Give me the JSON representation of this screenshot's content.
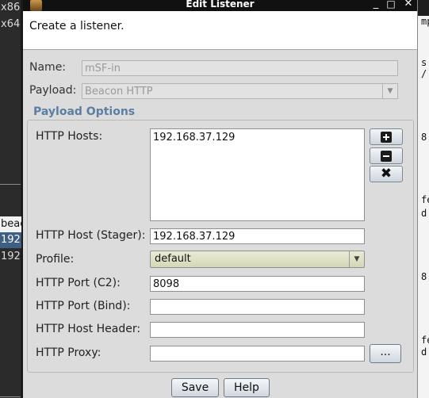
{
  "background_left": {
    "rows": [
      "x86",
      "x64",
      "",
      "",
      "",
      "",
      "",
      "",
      "",
      "",
      "",
      "",
      "",
      "beac",
      "192",
      "192"
    ]
  },
  "background_right": {
    "lines": [
      "mp",
      "s",
      "/",
      "8",
      "fe",
      "d",
      "8",
      "fe",
      "d"
    ]
  },
  "window": {
    "title": "Edit Listener",
    "controls": {
      "minimize": "_",
      "maximize": "□",
      "close": "✕"
    }
  },
  "header": {
    "description": "Create a listener."
  },
  "form": {
    "name_label": "Name:",
    "name_value": "mSF-in",
    "payload_label": "Payload:",
    "payload_value": "Beacon HTTP",
    "payload_options_title": "Payload Options",
    "http_hosts_label": "HTTP Hosts:",
    "http_hosts": [
      "192.168.37.129"
    ],
    "http_host_stager_label": "HTTP Host (Stager):",
    "http_host_stager_value": "192.168.37.129",
    "profile_label": "Profile:",
    "profile_value": "default",
    "http_port_c2_label": "HTTP Port (C2):",
    "http_port_c2_value": "8098",
    "http_port_bind_label": "HTTP Port (Bind):",
    "http_port_bind_value": "",
    "http_host_header_label": "HTTP Host Header:",
    "http_host_header_value": "",
    "http_proxy_label": "HTTP Proxy:",
    "http_proxy_value": "",
    "proxy_button_label": "..."
  },
  "buttons": {
    "save": "Save",
    "help": "Help"
  },
  "icons": {
    "add_host": "plus-icon",
    "remove_host": "minus-icon",
    "clear_hosts": "x-icon",
    "dropdown": "chevron-down-icon",
    "app_icon": "app-icon"
  },
  "colors": {
    "group_title": "#5b7ea3",
    "profile_bg": "#dfe3c4",
    "selected_row": "#3d5f86"
  }
}
